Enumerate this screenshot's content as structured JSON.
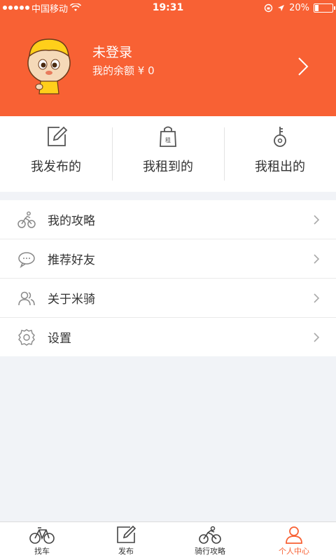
{
  "status_bar": {
    "carrier": "中国移动",
    "time": "19:31",
    "battery": "20%",
    "battery_level": 0.2
  },
  "profile": {
    "name": "未登录",
    "balance_label": "我的余额 ¥ 0"
  },
  "actions": [
    {
      "label": "我发布的",
      "icon": "edit-icon"
    },
    {
      "label": "我租到的",
      "icon": "rent-bag-icon",
      "icon_text": "租"
    },
    {
      "label": "我租出的",
      "icon": "key-icon"
    }
  ],
  "menu": [
    {
      "label": "我的攻略",
      "icon": "cyclist-icon"
    },
    {
      "label": "推荐好友",
      "icon": "chat-bubble-icon"
    },
    {
      "label": "关于米骑",
      "icon": "users-icon"
    },
    {
      "label": "设置",
      "icon": "gear-icon"
    }
  ],
  "tabs": [
    {
      "label": "找车",
      "icon": "bicycle-icon"
    },
    {
      "label": "发布",
      "icon": "edit-icon"
    },
    {
      "label": "骑行攻略",
      "icon": "cyclist-icon"
    },
    {
      "label": "个人中心",
      "icon": "person-icon",
      "active": true
    }
  ],
  "colors": {
    "accent": "#f86134",
    "background": "#f1f3f7"
  }
}
